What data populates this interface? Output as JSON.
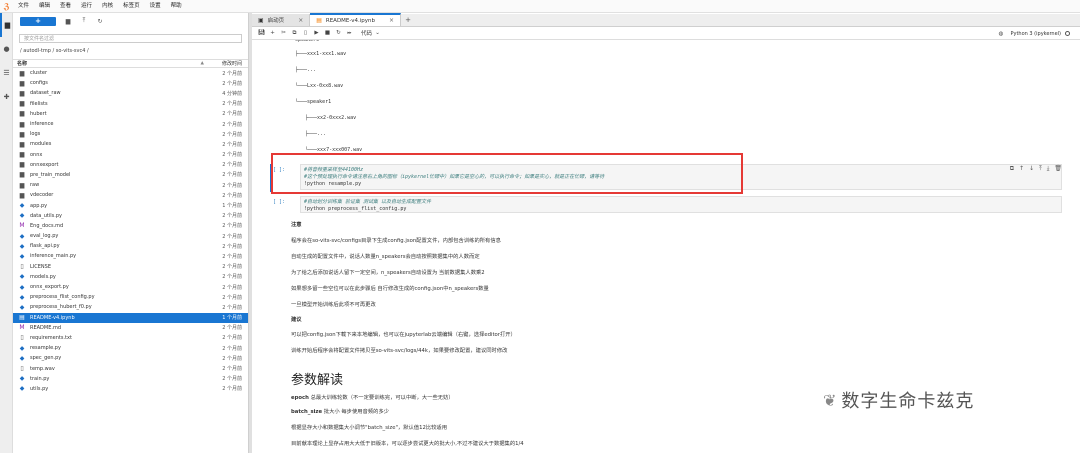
{
  "menubar": {
    "items": [
      "文件",
      "编辑",
      "查看",
      "运行",
      "内核",
      "标签页",
      "设置",
      "帮助"
    ]
  },
  "filebrowser": {
    "new_label": "+",
    "filter_placeholder": "按文件名过滤",
    "breadcrumb": "/ autodl-tmp / so-vits-svc4 /",
    "col_name": "名称",
    "col_modified": "修改时间",
    "files": [
      {
        "name": "cluster",
        "type": "folder",
        "time": "2 个月前"
      },
      {
        "name": "configs",
        "type": "folder",
        "time": "2 个月前"
      },
      {
        "name": "dataset_raw",
        "type": "folder",
        "time": "4 分钟前"
      },
      {
        "name": "filelists",
        "type": "folder",
        "time": "2 个月前"
      },
      {
        "name": "hubert",
        "type": "folder",
        "time": "2 个月前"
      },
      {
        "name": "inference",
        "type": "folder",
        "time": "2 个月前"
      },
      {
        "name": "logs",
        "type": "folder",
        "time": "2 个月前"
      },
      {
        "name": "modules",
        "type": "folder",
        "time": "2 个月前"
      },
      {
        "name": "onnx",
        "type": "folder",
        "time": "2 个月前"
      },
      {
        "name": "onnxexport",
        "type": "folder",
        "time": "2 个月前"
      },
      {
        "name": "pre_train_model",
        "type": "folder",
        "time": "2 个月前"
      },
      {
        "name": "raw",
        "type": "folder",
        "time": "2 个月前"
      },
      {
        "name": "vdecoder",
        "type": "folder",
        "time": "2 个月前"
      },
      {
        "name": "app.py",
        "type": "py",
        "time": "1 个月前"
      },
      {
        "name": "data_utils.py",
        "type": "py",
        "time": "2 个月前"
      },
      {
        "name": "Eng_docs.md",
        "type": "md",
        "time": "2 个月前"
      },
      {
        "name": "eval_log.py",
        "type": "py",
        "time": "2 个月前"
      },
      {
        "name": "flask_api.py",
        "type": "py",
        "time": "2 个月前"
      },
      {
        "name": "inference_main.py",
        "type": "py",
        "time": "2 个月前"
      },
      {
        "name": "LICENSE",
        "type": "txt",
        "time": "2 个月前"
      },
      {
        "name": "models.py",
        "type": "py",
        "time": "2 个月前"
      },
      {
        "name": "onnx_export.py",
        "type": "py",
        "time": "2 个月前"
      },
      {
        "name": "preprocess_flist_config.py",
        "type": "py",
        "time": "2 个月前"
      },
      {
        "name": "preprocess_hubert_f0.py",
        "type": "py",
        "time": "2 个月前"
      },
      {
        "name": "README-v4.ipynb",
        "type": "nb",
        "time": "1 个月前",
        "selected": true
      },
      {
        "name": "README.md",
        "type": "md",
        "time": "2 个月前"
      },
      {
        "name": "requirements.txt",
        "type": "txt",
        "time": "2 个月前"
      },
      {
        "name": "resample.py",
        "type": "py",
        "time": "2 个月前"
      },
      {
        "name": "spec_gen.py",
        "type": "py",
        "time": "2 个月前"
      },
      {
        "name": "temp.wav",
        "type": "txt",
        "time": "2 个月前"
      },
      {
        "name": "train.py",
        "type": "py",
        "time": "2 个月前"
      },
      {
        "name": "utils.py",
        "type": "py",
        "time": "2 个月前"
      }
    ]
  },
  "tabs": [
    {
      "label": "启动页",
      "icon": "launcher-icon"
    },
    {
      "label": "README-v4.ipynb",
      "icon": "notebook-icon"
    }
  ],
  "nbtoolbar": {
    "cell_type": "代码",
    "kernel_name": "Python 3 (ipykernel)"
  },
  "notebook": {
    "tree_lines": [
      "speaker0",
      "├───xxx1-xxx1.wav",
      "├───...",
      "└───Lxx-0xx8.wav",
      "└───speaker1",
      "├───xx2-0xxx2.wav",
      "├───...",
      "└───xxx7-xxx007.wav"
    ],
    "cell1": {
      "prompt": "[ ]:",
      "comment1": "#将音频重采样至44100Hz",
      "comment2": "#这个预处理执行命令请注意右上角的图标（ipykernel忙碌中）如果它是空心的，可以执行命令；如果是实心，就是正在忙碌，请等待",
      "command": "!python resample.py"
    },
    "cell2": {
      "prompt": "[ ]:",
      "comment": "#自动划分训练集 验证集 测试集 以及自动生成配置文件",
      "command": "!python preprocess_flist_config.py"
    },
    "md": {
      "note_title": "注意",
      "p1": "程序会在so-vits-svc/configs目录下生成config.json配置文件，内部包含训练的所有信息",
      "p2": "自动生成的配置文件中，说话人数量n_speakers会自动按照数据集中的人数而定",
      "p3": "为了给之后添加说话人留下一定空间，n_speakers自动设置为 当前数据集人数乘2",
      "p4": "如果想多留一些空位可以在此步骤后 自行修改生成的config.json中n_speakers数量",
      "p5": "一旦模型开始训练后此项不可再更改",
      "suggest_title": "建议",
      "p6": "可以把config.json下载下来本地编辑，也可以在jupyterlab云端编辑（右键，选择editor打开）",
      "p7": "训练开始后程序会将配置文件拷贝至so-vits-svc/logs/44k，如果要修改配置，建议同时修改",
      "h1": "参数解读",
      "epoch_label": "epoch",
      "epoch_desc": "总最大训练轮数（不一定要训练完，可以中断，大一些无妨）",
      "batch_label": "batch_size",
      "batch_desc": "批大小 每步使用音频的多少",
      "p8": "根据显存大小和数据集大小调节\"batch_size\"，默认值12比较适用",
      "p9": "目前献本理论上显存占用大大低于旧版本，可以逐步尝试更大的批大小,不过不建议大于数据集的1/4"
    }
  },
  "watermark": {
    "text": "数字生命卡兹克"
  }
}
